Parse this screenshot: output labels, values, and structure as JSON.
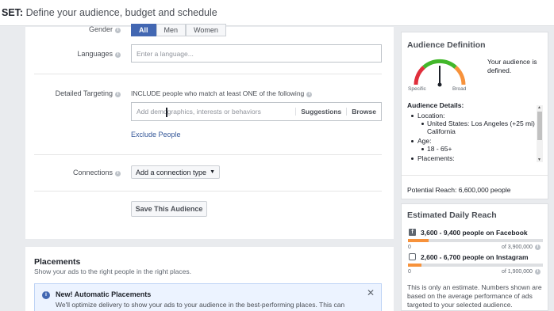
{
  "header": {
    "prefix": "SET:",
    "title": "Define your audience, budget and schedule"
  },
  "colors": {
    "accent": "#4267b2",
    "link": "#365899",
    "reach_bar": "#f7923b"
  },
  "gender": {
    "label": "Gender",
    "options": [
      "All",
      "Men",
      "Women"
    ],
    "selected": "All"
  },
  "languages": {
    "label": "Languages",
    "placeholder": "Enter a language..."
  },
  "targeting": {
    "label": "Detailed Targeting",
    "include_text": "INCLUDE people who match at least ONE of the following",
    "placeholder": "Add demographics, interests or behaviors",
    "suggestions": "Suggestions",
    "browse": "Browse",
    "exclude": "Exclude People"
  },
  "connections": {
    "label": "Connections",
    "button": "Add a connection type"
  },
  "save_button": "Save This Audience",
  "placements": {
    "title": "Placements",
    "subtitle": "Show your ads to the right people in the right places.",
    "notice_title": "New! Automatic Placements",
    "notice_body": "We'll optimize delivery to show your ads to your audience in the best-performing places. This can"
  },
  "audience_definition": {
    "title": "Audience Definition",
    "status": "Your audience is defined.",
    "gauge_left": "Specific",
    "gauge_right": "Broad",
    "details_title": "Audience Details:",
    "location_label": "Location:",
    "location_value": "United States: Los Angeles (+25 mi) California",
    "age_label": "Age:",
    "age_value": "18 - 65+",
    "placements_label": "Placements:",
    "potential_reach": "Potential Reach: 6,600,000 people"
  },
  "daily_reach": {
    "title": "Estimated Daily Reach",
    "facebook": {
      "text": "3,600 - 9,400 people on Facebook",
      "min": "0",
      "max": "of 3,900,000",
      "fill": 0.15
    },
    "instagram": {
      "text": "2,600 - 6,700 people on Instagram",
      "min": "0",
      "max": "of 1,900,000",
      "fill": 0.1
    },
    "note": "This is only an estimate. Numbers shown are based on the average performance of ads targeted to your selected audience."
  }
}
